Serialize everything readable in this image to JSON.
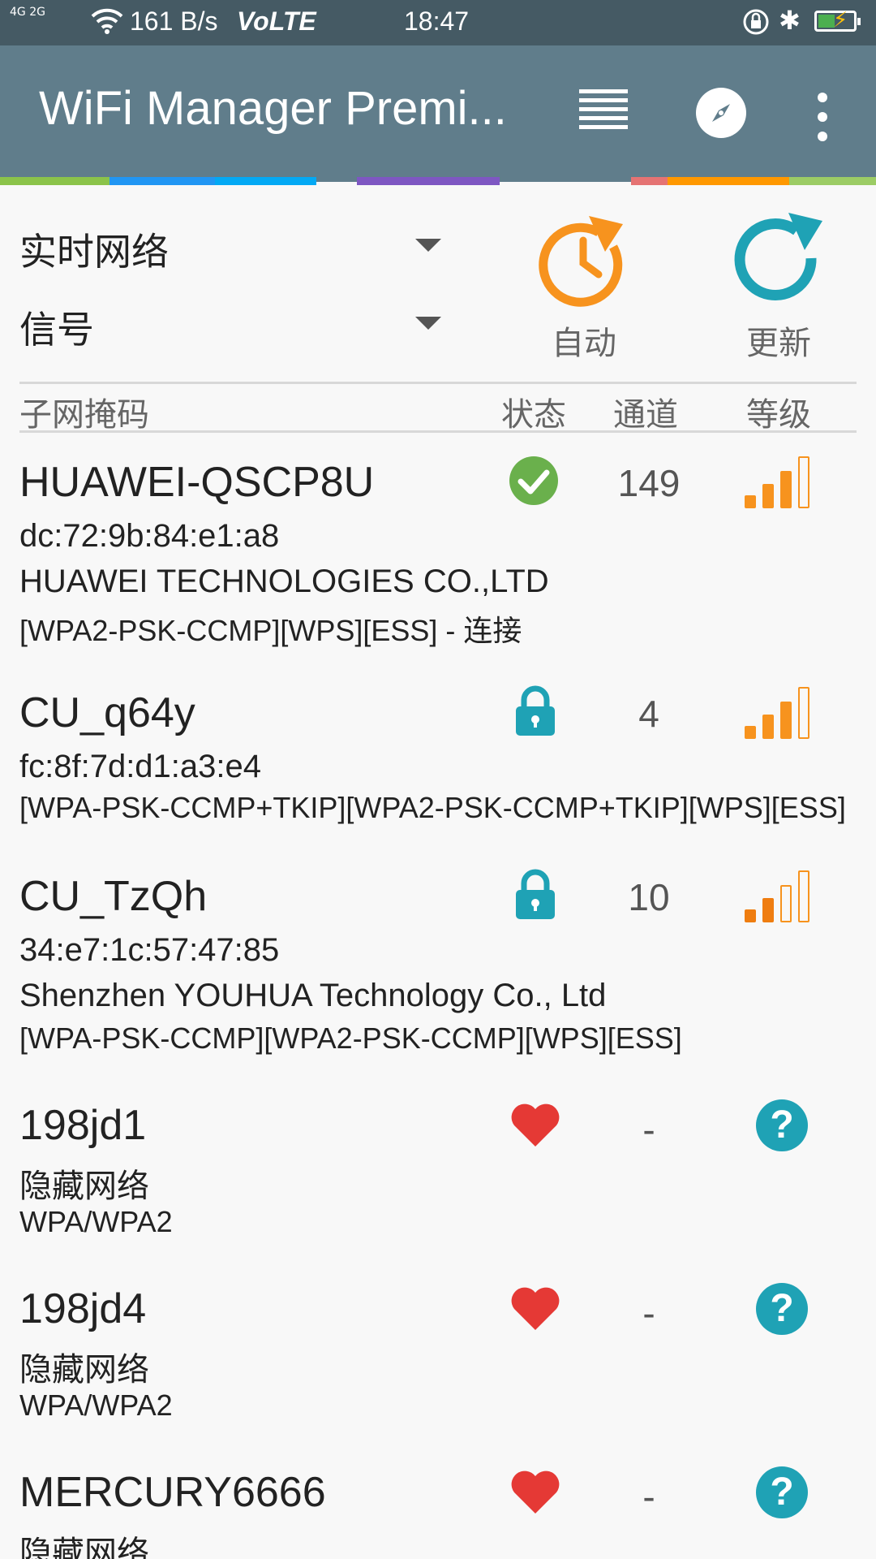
{
  "status_bar": {
    "signal": "4G 2G",
    "net_speed": "161 B/s",
    "volte": "VoLTE",
    "time": "18:47"
  },
  "app_bar": {
    "title": "WiFi Manager Premi..."
  },
  "controls": {
    "dropdown_mode": "实时网络",
    "dropdown_sort": "信号",
    "auto_label": "自动",
    "refresh_label": "更新"
  },
  "table_header": {
    "col_name": "子网掩码",
    "col_status": "状态",
    "col_channel": "通道",
    "col_level": "等级"
  },
  "networks": [
    {
      "ssid": "HUAWEI-QSCP8U",
      "mac": "dc:72:9b:84:e1:a8",
      "vendor": "HUAWEI TECHNOLOGIES CO.,LTD",
      "security": "[WPA2-PSK-CCMP][WPS][ESS] - 连接",
      "status_icon": "connected-check-icon",
      "channel": "149",
      "signal_bars": 3
    },
    {
      "ssid": "CU_q64y",
      "mac": "fc:8f:7d:d1:a3:e4",
      "security": "[WPA-PSK-CCMP+TKIP][WPA2-PSK-CCMP+TKIP][WPS][ESS]",
      "status_icon": "lock-icon",
      "channel": "4",
      "signal_bars": 3
    },
    {
      "ssid": "CU_TzQh",
      "mac": "34:e7:1c:57:47:85",
      "vendor": "Shenzhen YOUHUA Technology Co., Ltd",
      "security": "[WPA-PSK-CCMP][WPA2-PSK-CCMP][WPS][ESS]",
      "status_icon": "lock-icon",
      "channel": "10",
      "signal_bars": 2
    },
    {
      "ssid": "198jd1",
      "hidden_label": "隐藏网络",
      "security": "WPA/WPA2",
      "status_icon": "heart-icon",
      "channel": "-",
      "level_icon": "help-icon"
    },
    {
      "ssid": "198jd4",
      "hidden_label": "隐藏网络",
      "security": "WPA/WPA2",
      "status_icon": "heart-icon",
      "channel": "-",
      "level_icon": "help-icon"
    },
    {
      "ssid": "MERCURY6666",
      "hidden_label": "隐藏网络",
      "status_icon": "heart-icon",
      "channel": "-",
      "level_icon": "help-icon"
    }
  ],
  "colors": {
    "status_bar": "#455a64",
    "app_bar": "#607d8b",
    "accent_orange": "#f7931e",
    "accent_teal": "#1fa2b5",
    "check_green": "#6ab04c",
    "heart_red": "#e53935"
  }
}
